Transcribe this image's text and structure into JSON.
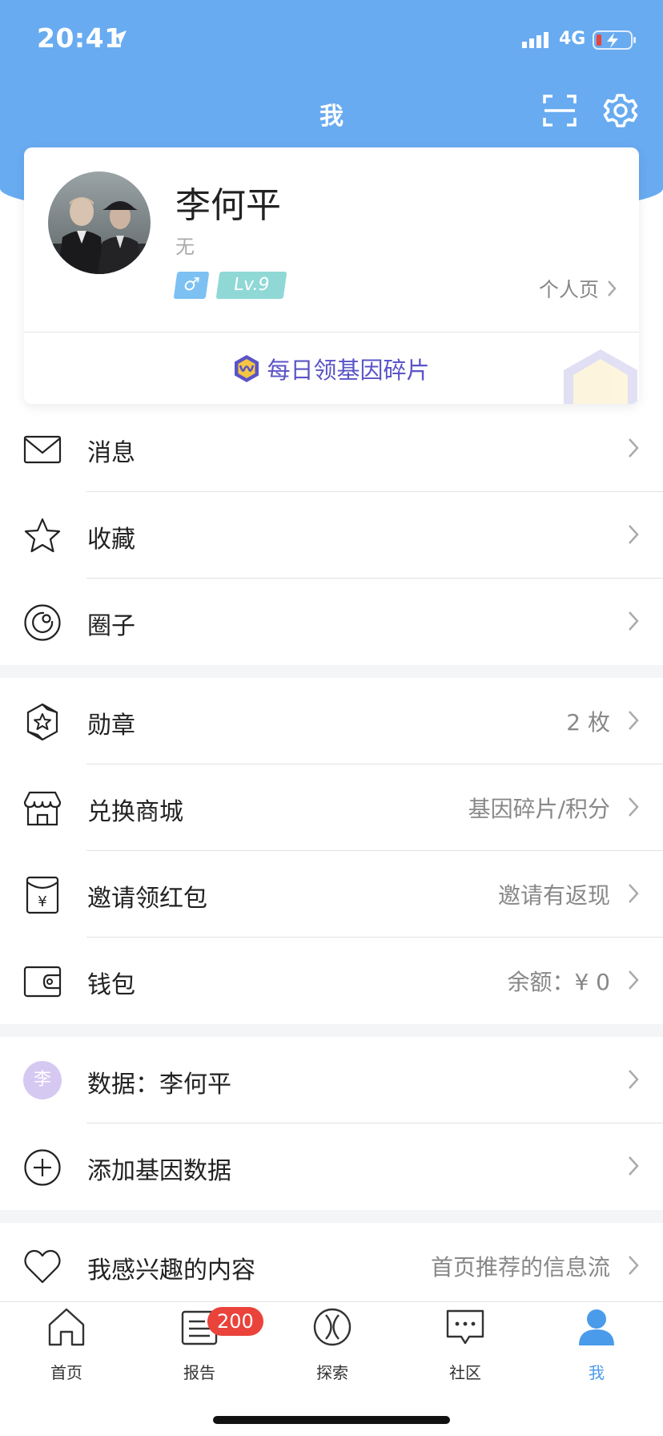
{
  "status_bar": {
    "time": "20:41",
    "network": "4G"
  },
  "header": {
    "title": "我"
  },
  "profile": {
    "name": "李何平",
    "bio": "无",
    "gender_symbol": "♂",
    "level": "Lv.9",
    "profile_link": "个人页",
    "daily_reward": "每日领基因碎片"
  },
  "menu_group_1": [
    {
      "label": "消息",
      "icon": "mail-icon"
    },
    {
      "label": "收藏",
      "icon": "star-icon"
    },
    {
      "label": "圈子",
      "icon": "circle-icon"
    }
  ],
  "menu_group_2": [
    {
      "label": "勋章",
      "value": "2 枚",
      "icon": "medal-icon"
    },
    {
      "label": "兑换商城",
      "value": "基因碎片/积分",
      "icon": "shop-icon"
    },
    {
      "label": "邀请领红包",
      "value": "邀请有返现",
      "icon": "red-packet-icon"
    },
    {
      "label": "钱包",
      "value": "余额：¥ 0",
      "icon": "wallet-icon"
    }
  ],
  "menu_group_3": [
    {
      "label": "数据：李何平",
      "avatar_initial": "李",
      "icon": "initial-avatar"
    },
    {
      "label": "添加基因数据",
      "icon": "plus-circle-icon"
    }
  ],
  "menu_group_4": [
    {
      "label": "我感兴趣的内容",
      "value": "首页推荐的信息流",
      "icon": "heart-icon"
    }
  ],
  "tabs": [
    {
      "label": "首页",
      "icon": "home-icon"
    },
    {
      "label": "报告",
      "icon": "report-icon",
      "badge": "200"
    },
    {
      "label": "探索",
      "icon": "explore-icon"
    },
    {
      "label": "社区",
      "icon": "community-icon"
    },
    {
      "label": "我",
      "icon": "person-icon",
      "active": true
    }
  ],
  "colors": {
    "header_blue": "#68abf0",
    "active_tab": "#4a9bea",
    "badge_red": "#e9433b",
    "reward_purple": "#5a54c7"
  }
}
